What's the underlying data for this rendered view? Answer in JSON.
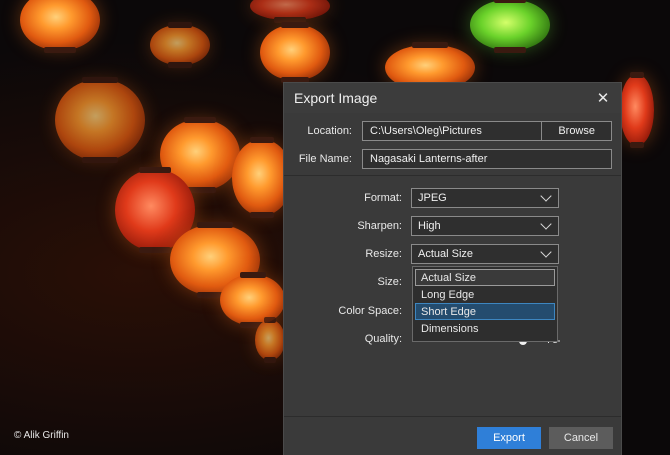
{
  "photo": {
    "credit": "© Alik Griffin"
  },
  "dialog": {
    "title": "Export Image",
    "close_icon": "close-icon",
    "location_label": "Location:",
    "location_value": "C:\\Users\\Oleg\\Pictures",
    "browse_label": "Browse",
    "filename_label": "File Name:",
    "filename_value": "Nagasaki Lanterns-after",
    "format_label": "Format:",
    "format_value": "JPEG",
    "sharpen_label": "Sharpen:",
    "sharpen_value": "High",
    "resize_label": "Resize:",
    "resize_value": "Actual Size",
    "size_label": "Size:",
    "colorspace_label": "Color Space:",
    "quality_label": "Quality:",
    "quality_value": "75",
    "quality_fraction": 0.75,
    "resize_options": [
      "Actual Size",
      "Long Edge",
      "Short Edge",
      "Dimensions"
    ],
    "export_label": "Export",
    "cancel_label": "Cancel",
    "colors": {
      "accent": "#2f7fd8",
      "slider_fill": "#e8a020",
      "hover_option": "#244c6e"
    }
  }
}
